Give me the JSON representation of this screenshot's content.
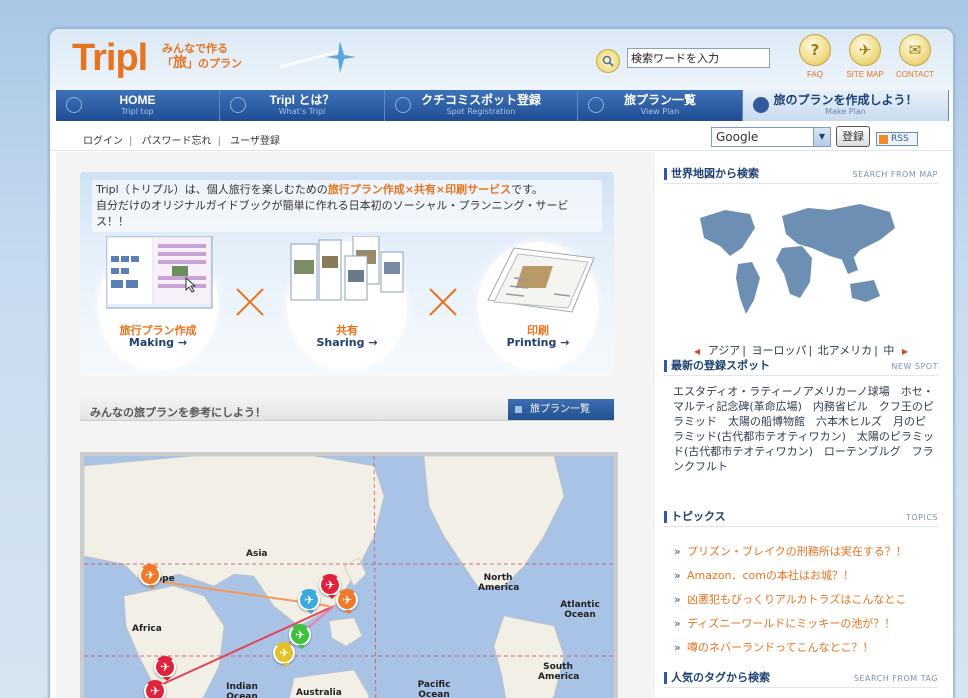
{
  "header": {
    "logo": "Tripl",
    "tagline_line1": "みんなで作る",
    "tagline_line2_pre": "「",
    "tagline_line2_big": "旅",
    "tagline_line2_post": "」のプラン",
    "search_placeholder": "検索ワードを入力",
    "icons": [
      {
        "label": "FAQ",
        "glyph": "?",
        "icon": "question-icon"
      },
      {
        "label": "SITE MAP",
        "glyph": "✈",
        "icon": "plane-icon"
      },
      {
        "label": "CONTACT",
        "glyph": "✉",
        "icon": "envelope-icon"
      }
    ]
  },
  "nav": [
    {
      "ja": "HOME",
      "en": "Tripl top"
    },
    {
      "ja": "Tripl とは？",
      "en": "What's Tripl"
    },
    {
      "ja": "クチコミスポット登録",
      "en": "Spot Registration"
    },
    {
      "ja": "旅プラン一覧",
      "en": "View Plan"
    },
    {
      "ja": "旅のプランを作成しよう！",
      "en": "Make Plan"
    }
  ],
  "subbar": {
    "links": [
      "ログイン",
      "パスワード忘れ",
      "ユーザ登録"
    ],
    "select_value": "Google",
    "register_button": "登録",
    "rss": "RSS"
  },
  "intro": {
    "text_pre": "Tripl（トリプル）は、個人旅行を楽しむための",
    "text_hl": "旅行プラン作成×共有×印刷サービス",
    "text_post": "です。",
    "line2": "自分だけのオリジナルガイドブックが簡単に作れる日本初のソーシャル・プランニング・サービス！！",
    "features": [
      {
        "ja": "旅行プラン作成",
        "en": "Making →"
      },
      {
        "ja": "共有",
        "en": "Sharing →"
      },
      {
        "ja": "印刷",
        "en": "Printing →"
      }
    ]
  },
  "plans": {
    "title": "みんなの旅プランを参考にしよう！",
    "button": "旅プラン一覧"
  },
  "map": {
    "labels": [
      "Asia",
      "North America",
      "Atlantic Ocean",
      "Africa",
      "South America",
      "Indian Ocean",
      "Australia",
      "Pacific Ocean",
      "ope"
    ]
  },
  "sidebar": {
    "world": {
      "title": "世界地図から検索",
      "en": "SEARCH FROM MAP",
      "regions": [
        "アジア",
        "ヨーロッパ",
        "北アメリカ",
        "中"
      ]
    },
    "spots": {
      "title": "最新の登録スポット",
      "en": "NEW SPOT",
      "text": "エスタディオ・ラティーノアメリカーノ球場　ホセ・マルティ記念碑(革命広場)　内務省ビル　クフ王のピラミッド　太陽の船博物館　六本木ヒルズ　月のピラミッド(古代都市テオティワカン)　太陽のピラミッド(古代都市テオティワカン)　ローテンブルグ　フランクフルト"
    },
    "topics": {
      "title": "トピックス",
      "en": "TOPICS",
      "items": [
        "プリズン・ブレイクの刑務所は実在する？！",
        "Amazon．comの本社はお城？！",
        "凶悪犯もびっくりアルカトラズはこんなとこ",
        "ディズニーワールドにミッキーの池が？！",
        "噂のネバーランドってこんなとこ？！"
      ]
    },
    "tags": {
      "title": "人気のタグから検索",
      "en": "SEARCH FROM TAG"
    }
  },
  "colors": {
    "accent": "#e8731e",
    "nav": "#2b5ea3",
    "link": "#1d3f72"
  }
}
